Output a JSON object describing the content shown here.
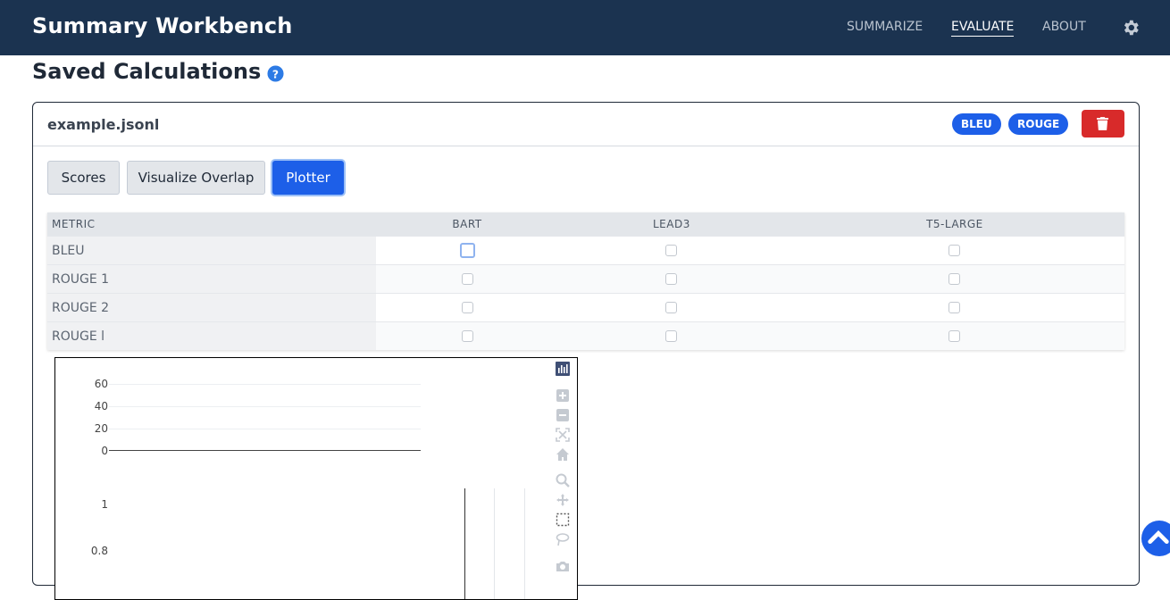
{
  "header": {
    "title": "Summary Workbench",
    "nav": [
      "SUMMARIZE",
      "EVALUATE",
      "ABOUT"
    ],
    "active_nav": "EVALUATE"
  },
  "section": {
    "title": "Saved Calculations"
  },
  "card": {
    "file_name": "example.jsonl",
    "badges": [
      "BLEU",
      "ROUGE"
    ],
    "tabs": [
      "Scores",
      "Visualize Overlap",
      "Plotter"
    ],
    "active_tab": "Plotter"
  },
  "table": {
    "headers": [
      "METRIC",
      "BART",
      "LEAD3",
      "T5-LARGE"
    ],
    "rows": [
      "BLEU",
      "ROUGE 1",
      "ROUGE 2",
      "ROUGE l"
    ]
  },
  "plot": {
    "upper_ticks": [
      "60",
      "40",
      "20",
      "0"
    ],
    "lower_ticks": [
      "1",
      "0.8"
    ]
  },
  "colors": {
    "header_bg": "#1b3350",
    "accent": "#1d5fe8",
    "danger": "#d82a2a"
  }
}
